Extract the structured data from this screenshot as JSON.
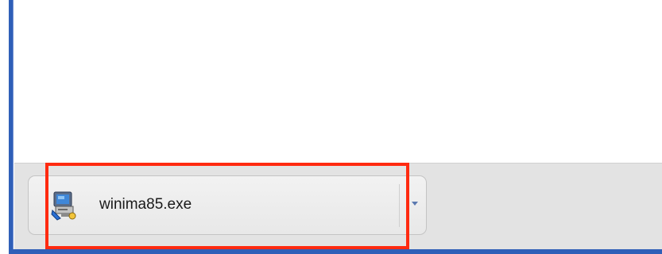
{
  "download_shelf": {
    "items": [
      {
        "file_name": "winima85.exe",
        "icon": "executable-installer-icon"
      }
    ],
    "dropdown_icon": "chevron-down-icon"
  },
  "colors": {
    "window_frame": "#2f5fb8",
    "highlight": "#ff2a10",
    "shelf_background": "#e3e3e3"
  }
}
